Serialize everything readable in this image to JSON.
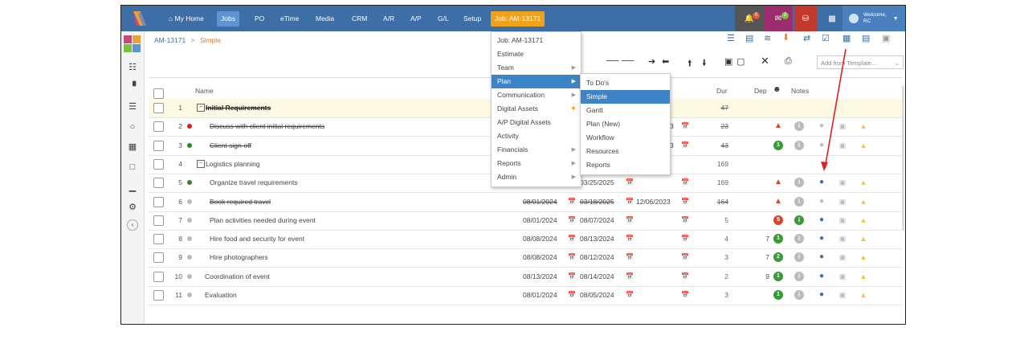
{
  "nav": {
    "items": [
      "My Home",
      "Jobs",
      "PO",
      "eTime",
      "Media",
      "CRM",
      "A/R",
      "A/P",
      "G/L",
      "Setup"
    ],
    "job_tab": "Job: AM-13171",
    "badges": {
      "alerts": "0",
      "mail": "0"
    },
    "welcome": "Welcome,",
    "user": "RC"
  },
  "breadcrumb": {
    "job": "AM-13171",
    "sep": ">",
    "current": "Simple"
  },
  "template_select": {
    "placeholder": "Add from Template..."
  },
  "columns": {
    "name": "Name",
    "dur": "Dur",
    "dep": "Dep",
    "notes": "Notes"
  },
  "job_menu": {
    "items": [
      "Job: AM-13171",
      "Estimate",
      "Team",
      "Plan",
      "Communication",
      "Digital Assets",
      "A/P Digital Assets",
      "Activity",
      "Financials",
      "Reports",
      "Admin"
    ]
  },
  "plan_menu": {
    "items": [
      "To Do's",
      "Simple",
      "Gantt",
      "Plan (New)",
      "Workflow",
      "Resources",
      "Reports"
    ]
  },
  "rows": [
    {
      "num": "1",
      "name": "Initial Requirements",
      "start": "",
      "end": "",
      "due": "",
      "dur": "47",
      "dep": "",
      "status": "",
      "alert": ""
    },
    {
      "num": "2",
      "name": "Discuss with client initial requirements",
      "start": "",
      "end": "",
      "due": "3",
      "dur": "23",
      "dep": "",
      "status": "",
      "alert": "warn"
    },
    {
      "num": "3",
      "name": "Client sign-off",
      "start": "",
      "end": "",
      "due": "3",
      "dur": "43",
      "dep": "",
      "status": "1",
      "alert": ""
    },
    {
      "num": "4",
      "name": "Logistics planning",
      "start": "",
      "end": "",
      "due": "",
      "dur": "169",
      "dep": "",
      "status": "",
      "alert": ""
    },
    {
      "num": "5",
      "name": "Organize travel requirements",
      "start": "",
      "end": "03/25/2025",
      "due": "",
      "dur": "169",
      "dep": "",
      "status": "",
      "alert": "warn"
    },
    {
      "num": "6",
      "name": "Book required travel",
      "start": "08/01/2024",
      "end": "03/18/2025",
      "due": "12/06/2023",
      "dur": "164",
      "dep": "",
      "status": "",
      "alert": "warn"
    },
    {
      "num": "7",
      "name": "Plan activities needed during event",
      "start": "08/01/2024",
      "end": "08/07/2024",
      "due": "",
      "dur": "5",
      "dep": "",
      "status": "5",
      "alert": ""
    },
    {
      "num": "8",
      "name": "Hire food and security for event",
      "start": "08/08/2024",
      "end": "08/13/2024",
      "due": "",
      "dur": "4",
      "dep": "7",
      "status": "1",
      "alert": ""
    },
    {
      "num": "9",
      "name": "Hire photographers",
      "start": "08/08/2024",
      "end": "08/12/2024",
      "due": "",
      "dur": "3",
      "dep": "7",
      "status": "2",
      "alert": ""
    },
    {
      "num": "10",
      "name": "Coordination of event",
      "start": "08/13/2024",
      "end": "08/14/2024",
      "due": "",
      "dur": "2",
      "dep": "9",
      "status": "1",
      "alert": ""
    },
    {
      "num": "11",
      "name": "Evaluation",
      "start": "08/01/2024",
      "end": "08/05/2024",
      "due": "",
      "dur": "3",
      "dep": "",
      "status": "1",
      "alert": ""
    }
  ],
  "colors": {
    "nav_bg": "#3d6ea5",
    "job_tab": "#f0a21a",
    "accent": "#3d84c6",
    "annotation_arrow": "#e02020"
  }
}
